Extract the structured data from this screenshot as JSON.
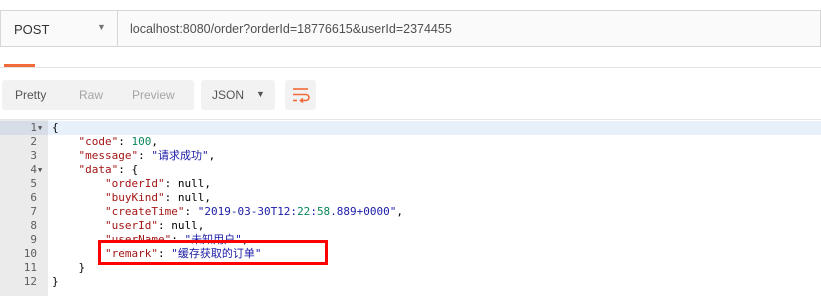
{
  "request": {
    "method": "POST",
    "url": "localhost:8080/order?orderId=18776615&userId=2374455"
  },
  "response_toolbar": {
    "pretty_label": "Pretty",
    "raw_label": "Raw",
    "preview_label": "Preview",
    "format_selected": "JSON",
    "wrap_icon": "wrap-lines-icon"
  },
  "colors": {
    "accent": "#f26b3a",
    "highlight_border": "#ff0000"
  },
  "code": {
    "lines": [
      {
        "n": "1",
        "text": "{"
      },
      {
        "n": "2",
        "text": "    \"code\": 100,"
      },
      {
        "n": "3",
        "text": "    \"message\": \"请求成功\","
      },
      {
        "n": "4",
        "text": "    \"data\": {"
      },
      {
        "n": "5",
        "text": "        \"orderId\": null,"
      },
      {
        "n": "6",
        "text": "        \"buyKind\": null,"
      },
      {
        "n": "7",
        "text": "        \"createTime\": \"2019-03-30T12:22:58.889+0000\","
      },
      {
        "n": "8",
        "text": "        \"userId\": null,"
      },
      {
        "n": "9",
        "text": "        \"userName\": \"未知用户\","
      },
      {
        "n": "10",
        "text": "        \"remark\": \"缓存获取的订单\""
      },
      {
        "n": "11",
        "text": "    }"
      },
      {
        "n": "12",
        "text": "}"
      }
    ]
  }
}
